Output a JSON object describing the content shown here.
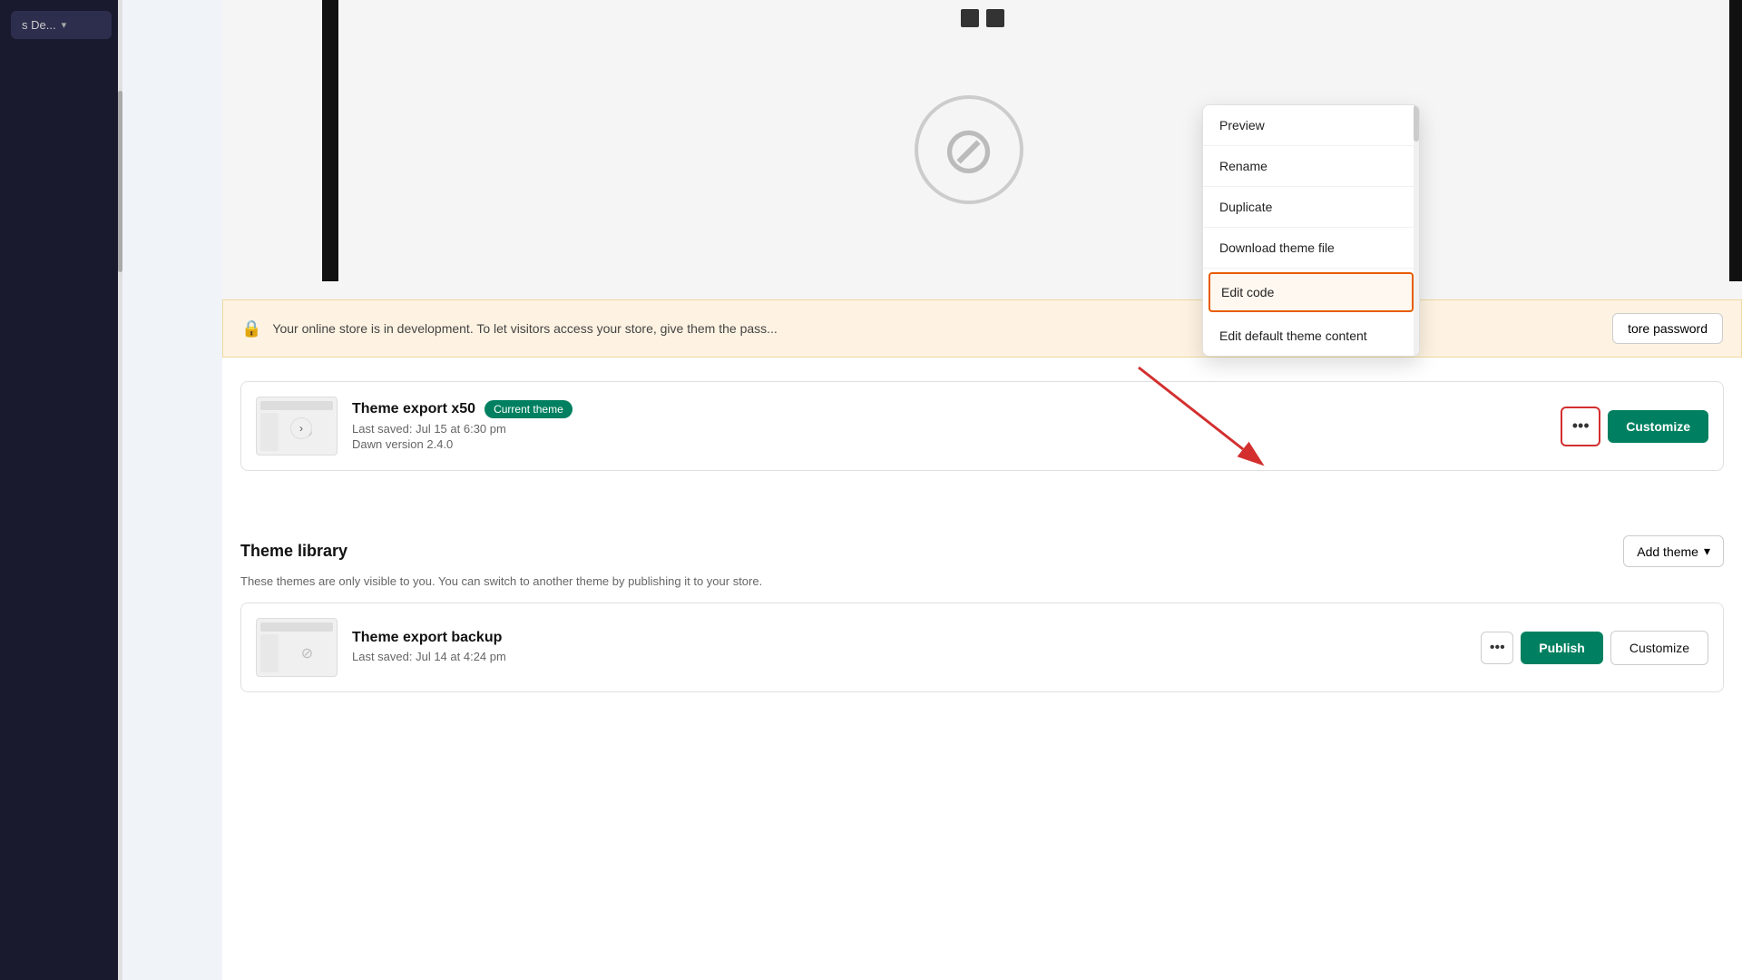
{
  "sidebar": {
    "brand_text": "s De...",
    "dropdown_icon": "▾"
  },
  "dev_banner": {
    "text": "Your online store is in development. To let visitors access your store, give them the pass...",
    "store_password_label": "tore password"
  },
  "current_theme": {
    "section_label": "Current theme",
    "theme_name": "Theme export x50",
    "badge": "Current theme",
    "last_saved": "Last saved: Jul 15 at 6:30 pm",
    "version": "Dawn version 2.4.0",
    "customize_label": "Customize",
    "dots_label": "•••"
  },
  "dropdown": {
    "preview_label": "Preview",
    "rename_label": "Rename",
    "duplicate_label": "Duplicate",
    "download_label": "Download theme file",
    "edit_code_label": "Edit code",
    "edit_default_label": "Edit default theme content"
  },
  "theme_library": {
    "title": "Theme library",
    "subtitle": "These themes are only visible to you. You can switch to another theme by publishing it to your store.",
    "add_theme_label": "Add theme",
    "theme_name": "Theme export backup",
    "last_saved": "Last saved: Jul 14 at 4:24 pm",
    "publish_label": "Publish",
    "customize_label": "Customize",
    "dots_label": "•••"
  }
}
